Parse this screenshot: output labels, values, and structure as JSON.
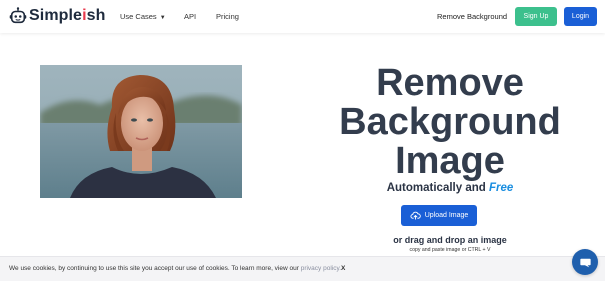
{
  "brand": {
    "name_prefix": "Simple",
    "name_accent": "i",
    "name_suffix": "sh"
  },
  "nav": {
    "use_cases": "Use Cases",
    "api": "API",
    "pricing": "Pricing",
    "remove_background": "Remove Background",
    "sign_up": "Sign Up",
    "login": "Login"
  },
  "hero": {
    "title_lines": [
      "Remove",
      "Background",
      "Image"
    ],
    "subtitle_prefix": "Automatically and ",
    "subtitle_free": "Free",
    "upload_label": "Upload Image",
    "drag_text": "or drag and drop an image",
    "paste_text": "copy and paste image or CTRL + V"
  },
  "cookie": {
    "text": "We use cookies, by continuing to use this site you accept our use of cookies. To learn more, view our ",
    "link": "privacy policy.",
    "close": "X"
  },
  "colors": {
    "brand_accent": "#e8394d",
    "signup_green": "#3cc08d",
    "primary_blue": "#1a5fd6",
    "free_blue": "#1a8ee0",
    "chat_blue": "#1f5fad"
  },
  "icons": [
    "robot-logo-icon",
    "chevron-down-icon",
    "upload-cloud-icon",
    "chat-icon"
  ]
}
